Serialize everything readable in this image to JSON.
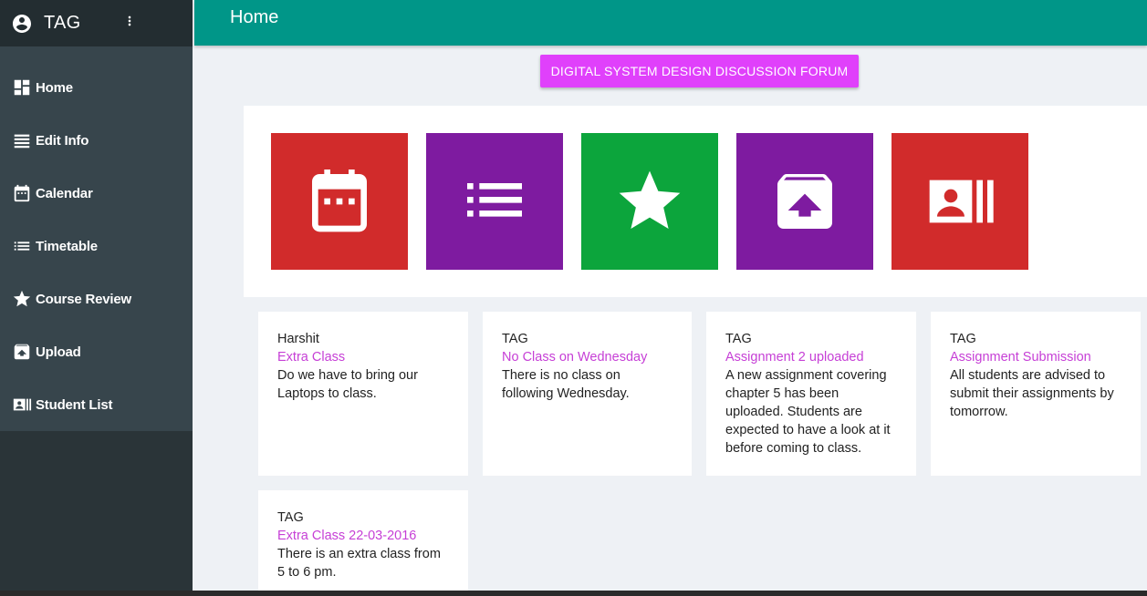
{
  "app": {
    "title": "TAG"
  },
  "header": {
    "title": "Home",
    "color": "#009688"
  },
  "sidebar": {
    "items": [
      {
        "label": "Home",
        "icon": "dashboard-icon"
      },
      {
        "label": "Edit Info",
        "icon": "list-icon"
      },
      {
        "label": "Calendar",
        "icon": "calendar-icon"
      },
      {
        "label": "Timetable",
        "icon": "timetable-icon"
      },
      {
        "label": "Course Review",
        "icon": "star-icon"
      },
      {
        "label": "Upload",
        "icon": "upload-icon"
      },
      {
        "label": "Student List",
        "icon": "contacts-icon"
      }
    ]
  },
  "forum_button": {
    "label": "DIGITAL SYSTEM DESIGN DISCUSSION FORUM",
    "color": "#e040fb"
  },
  "tiles": [
    {
      "icon": "calendar-icon",
      "color": "#d12b2b"
    },
    {
      "icon": "list-icon",
      "color": "#7e1ba0"
    },
    {
      "icon": "star-icon",
      "color": "#0ca53c"
    },
    {
      "icon": "upload-icon",
      "color": "#7e1ba0"
    },
    {
      "icon": "contacts-icon",
      "color": "#d12b2b"
    }
  ],
  "posts": [
    {
      "author": "Harshit",
      "subject": "Extra Class",
      "body": "Do we have to bring our Laptops to class."
    },
    {
      "author": "TAG",
      "subject": "No Class on Wednesday",
      "body": "There is no class on following Wednesday."
    },
    {
      "author": "TAG",
      "subject": "Assignment 2 uploaded",
      "body": "A new assignment covering chapter 5 has been uploaded. Students are expected to have a look at it before coming to class."
    },
    {
      "author": "TAG",
      "subject": "Assignment Submission",
      "body": "All students are advised to submit their assignments by tomorrow."
    },
    {
      "author": "TAG",
      "subject": "Extra Class 22-03-2016",
      "body": "There is an extra class from 5 to 6 pm."
    }
  ]
}
